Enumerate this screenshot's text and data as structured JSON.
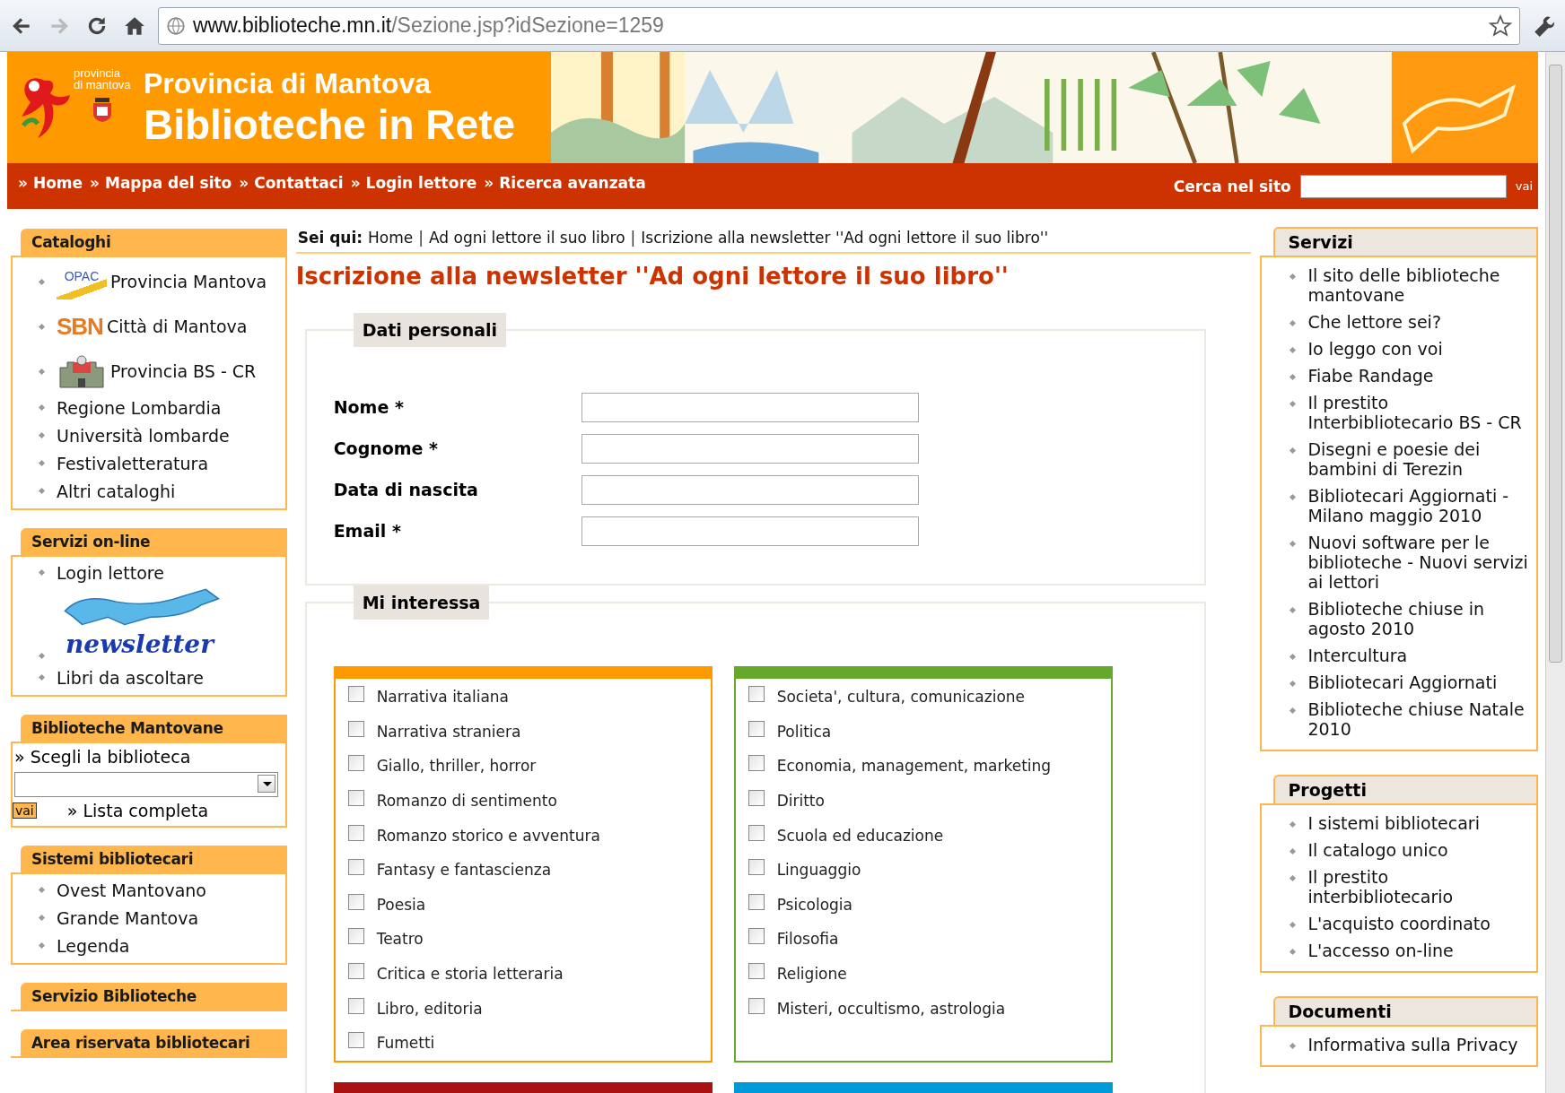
{
  "browser": {
    "url_host": "www.biblioteche.mn.it",
    "url_path": "/Sezione.jsp?idSezione=1259"
  },
  "header": {
    "logo_text": "provincia di mantova",
    "subtitle": "Provincia di Mantova",
    "title": "Biblioteche in Rete"
  },
  "nav": {
    "links": [
      "» Home",
      "» Mappa del sito",
      "» Contattaci",
      "» Login lettore",
      "» Ricerca avanzata"
    ],
    "search_label": "Cerca nel sito",
    "search_button": "vai"
  },
  "left_sidebar": [
    {
      "kind": "list",
      "heading": "Cataloghi",
      "items": [
        {
          "kind": "opac",
          "logo_text": "OPAC",
          "label": "Provincia Mantova"
        },
        {
          "kind": "sbn",
          "logo_text": "SBN",
          "label": "Città di Mantova"
        },
        {
          "kind": "castle",
          "label": "Provincia BS - CR"
        },
        {
          "kind": "link",
          "label": "Regione Lombardia"
        },
        {
          "kind": "link",
          "label": "Università lombarde"
        },
        {
          "kind": "link",
          "label": "Festivaletteratura"
        },
        {
          "kind": "link",
          "label": "Altri cataloghi"
        }
      ]
    },
    {
      "kind": "list",
      "heading": "Servizi on-line",
      "items": [
        {
          "kind": "link",
          "label": "Login lettore"
        },
        {
          "kind": "banner",
          "label": "newsletter"
        },
        {
          "kind": "link",
          "label": "Libri da ascoltare"
        }
      ]
    },
    {
      "kind": "select",
      "heading": "Biblioteche Mantovane",
      "prompt": "» Scegli la biblioteca",
      "button": "vai",
      "link": "» Lista completa"
    },
    {
      "kind": "list",
      "heading": "Sistemi bibliotecari",
      "items": [
        {
          "kind": "link",
          "label": "Ovest Mantovano"
        },
        {
          "kind": "link",
          "label": "Grande Mantova"
        },
        {
          "kind": "link",
          "label": "Legenda"
        }
      ]
    },
    {
      "kind": "heading",
      "heading": "Servizio Biblioteche"
    },
    {
      "kind": "heading",
      "heading": "Area riservata bibliotecari"
    }
  ],
  "breadcrumb": {
    "label": "Sei qui:",
    "crumbs": [
      {
        "kind": "link",
        "text": "Home"
      },
      {
        "kind": "sep",
        "text": "|"
      },
      {
        "kind": "link",
        "text": "Ad ogni lettore il suo libro"
      },
      {
        "kind": "sep",
        "text": "|"
      },
      {
        "kind": "link",
        "text": "Iscrizione alla newsletter ''Ad ogni lettore il suo libro''"
      }
    ]
  },
  "title": "Iscrizione alla newsletter ''Ad ogni lettore il suo libro''",
  "personal": {
    "legend": "Dati personali",
    "fields": [
      {
        "label": "Nome *"
      },
      {
        "label": "Cognome *"
      },
      {
        "label": "Data di nascita"
      },
      {
        "label": "Email *"
      }
    ]
  },
  "interests": {
    "legend": "Mi interessa",
    "groups": [
      {
        "color": "#ff9900",
        "options": [
          {
            "label": "Narrativa italiana",
            "checked": false
          },
          {
            "label": "Narrativa straniera",
            "checked": false
          },
          {
            "label": "Giallo, thriller, horror",
            "checked": false
          },
          {
            "label": "Romanzo di sentimento",
            "checked": false
          },
          {
            "label": "Romanzo storico e avventura",
            "checked": false
          },
          {
            "label": "Fantasy e fantascienza",
            "checked": false
          },
          {
            "label": "Poesia",
            "checked": false
          },
          {
            "label": "Teatro",
            "checked": false
          },
          {
            "label": "Critica e storia letteraria",
            "checked": false
          },
          {
            "label": "Libro, editoria",
            "checked": false
          },
          {
            "label": "Fumetti",
            "checked": false
          }
        ]
      },
      {
        "color": "#66a82c",
        "options": [
          {
            "label": "Societa', cultura, comunicazione",
            "checked": false
          },
          {
            "label": "Politica",
            "checked": false
          },
          {
            "label": "Economia, management, marketing",
            "checked": false
          },
          {
            "label": "Diritto",
            "checked": false
          },
          {
            "label": "Scuola ed educazione",
            "checked": false
          },
          {
            "label": "Linguaggio",
            "checked": false
          },
          {
            "label": "Psicologia",
            "checked": false
          },
          {
            "label": "Filosofia",
            "checked": false
          },
          {
            "label": "Religione",
            "checked": false
          },
          {
            "label": "Misteri, occultismo, astrologia",
            "checked": false
          }
        ]
      },
      {
        "color": "#aa1111"
      },
      {
        "color": "#0099d8"
      }
    ]
  },
  "right_sidebar": [
    {
      "heading": "Servizi",
      "items": [
        "Il sito delle biblioteche mantovane",
        "Che lettore sei?",
        "Io leggo con voi",
        "Fiabe Randage",
        "Il prestito Interbibliotecario BS - CR",
        "Disegni e poesie dei bambini di Terezin",
        "Bibliotecari Aggiornati - Milano maggio 2010",
        "Nuovi software per le biblioteche - Nuovi servizi ai lettori",
        "Biblioteche chiuse in agosto 2010",
        "Intercultura",
        "Bibliotecari Aggiornati",
        "Biblioteche chiuse Natale 2010"
      ]
    },
    {
      "heading": "Progetti",
      "items": [
        "I sistemi bibliotecari",
        "Il catalogo unico",
        "Il prestito interbibliotecario",
        "L'acquisto coordinato",
        "L'accesso on-line"
      ]
    },
    {
      "heading": "Documenti",
      "items": [
        "Informativa sulla Privacy"
      ]
    }
  ]
}
